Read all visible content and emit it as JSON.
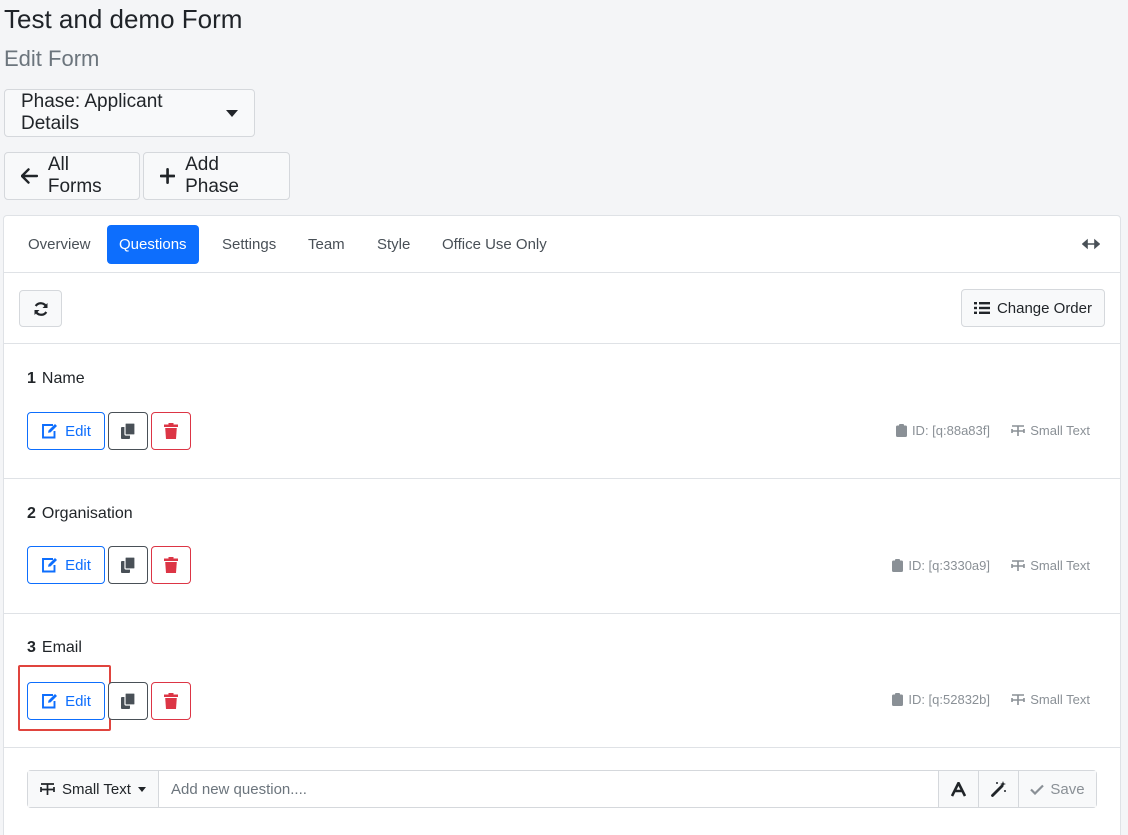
{
  "header": {
    "title": "Test and demo Form",
    "subtitle": "Edit Form"
  },
  "phase_button": {
    "label": "Phase: Applicant Details"
  },
  "actions": {
    "all_forms": "All Forms",
    "add_phase": "Add Phase"
  },
  "tabs": [
    {
      "label": "Overview",
      "active": false
    },
    {
      "label": "Questions",
      "active": true
    },
    {
      "label": "Settings",
      "active": false
    },
    {
      "label": "Team",
      "active": false
    },
    {
      "label": "Style",
      "active": false
    },
    {
      "label": "Office Use Only",
      "active": false
    }
  ],
  "toolbar": {
    "change_order": "Change Order"
  },
  "questions": [
    {
      "number": "1",
      "title": "Name",
      "edit_label": "Edit",
      "id_text": "ID: [q:88a83f]",
      "type": "Small Text"
    },
    {
      "number": "2",
      "title": "Organisation",
      "edit_label": "Edit",
      "id_text": "ID: [q:3330a9]",
      "type": "Small Text"
    },
    {
      "number": "3",
      "title": "Email",
      "edit_label": "Edit",
      "id_text": "ID: [q:52832b]",
      "type": "Small Text"
    }
  ],
  "add_question": {
    "type_label": "Small Text",
    "placeholder": "Add new question....",
    "save_label": "Save"
  },
  "colors": {
    "primary": "#0d6efd",
    "danger": "#dc3545",
    "highlight": "#e0443e"
  }
}
